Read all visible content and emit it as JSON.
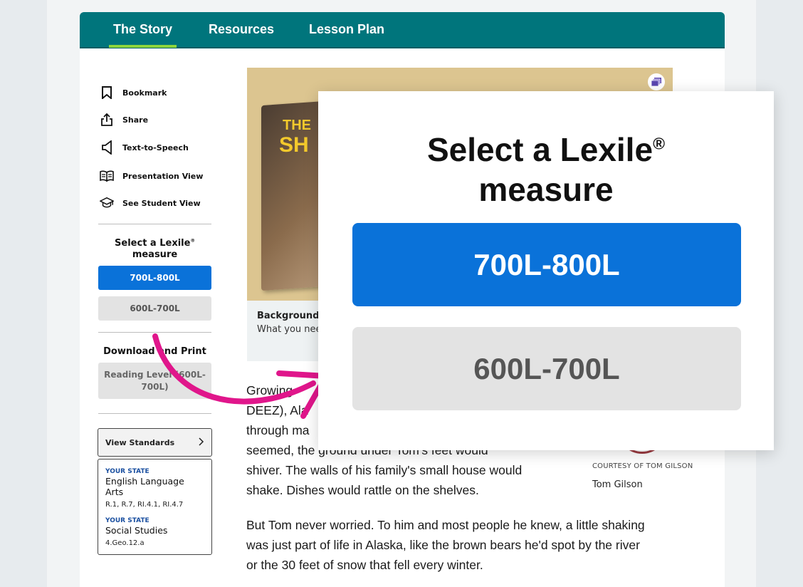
{
  "nav": {
    "tabs": [
      "The Story",
      "Resources",
      "Lesson Plan"
    ]
  },
  "tools": [
    "Bookmark",
    "Share",
    "Text-to-Speech",
    "Presentation View",
    "See Student View"
  ],
  "lexile": {
    "heading": "Select a Lexile",
    "reg": "®",
    "heading2": "measure",
    "selected": "700L-800L",
    "other": "600L-700L"
  },
  "download": {
    "heading": "Download and Print",
    "reading_level": "Reading Level (600L-700L)"
  },
  "standards": {
    "button": "View Standards",
    "state_label": "YOUR STATE",
    "ela": "English Language Arts",
    "ela_codes": "R.1, R.7, RI.4.1, RI.4.7",
    "state_label2": "YOUR STATE",
    "ss": "Social Studies",
    "ss_codes": "4.Geo.12.a"
  },
  "hero": {
    "book_title_1": "THE",
    "book_title_2": "SH"
  },
  "caption": {
    "title": "Background E",
    "sub": "What you nee"
  },
  "article": {
    "p1_l1": "Growing",
    "p1_l2": "DEEZ), Ala",
    "p1_l3": "through ma",
    "p1_l4": "seemed, the ground under Tom's feet would",
    "p1_l5": "shiver. The walls of his family's small house would",
    "p1_l6": "shake. Dishes would rattle on the shelves.",
    "p2_l1": "But Tom never worried. To him and most people he knew, a little shaking",
    "p2_l2": "was just part of life in Alaska, like the brown bears he'd spot by the river",
    "p2_l3": "or the 30 feet of snow that fell every winter."
  },
  "photo": {
    "credit": "COURTESY OF TOM GILSON",
    "name": "Tom Gilson"
  },
  "popup": {
    "title_1": "Select a Lexile",
    "reg": "®",
    "title_2": "measure",
    "selected": "700L-800L",
    "other": "600L-700L"
  },
  "colors": {
    "nav": "#00757c",
    "accent_underline": "#8dd53c",
    "selected": "#0a72d9",
    "arrow": "#e0168b"
  }
}
